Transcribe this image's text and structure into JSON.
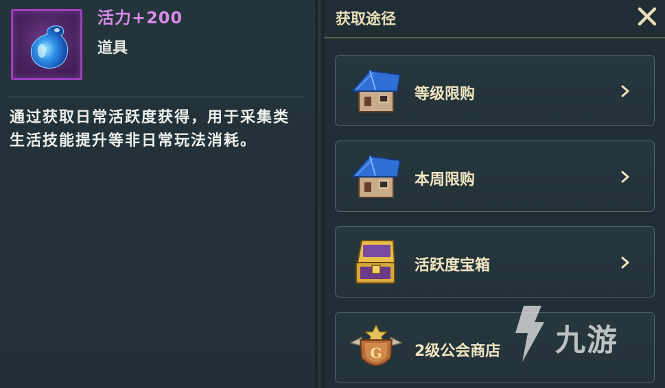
{
  "item": {
    "name": "活力+200",
    "type": "道具",
    "description": "通过获取日常活跃度获得，用于采集类生活技能提升等非日常玩法消耗。",
    "icon": "blue-droplet-icon"
  },
  "acquire_panel": {
    "title": "获取途径",
    "close_icon": "close-icon",
    "sources": [
      {
        "label": "等级限购",
        "icon": "blue-roof-house-icon"
      },
      {
        "label": "本周限购",
        "icon": "blue-roof-house-icon"
      },
      {
        "label": "活跃度宝箱",
        "icon": "gold-treasure-chest-icon"
      },
      {
        "label": "2级公会商店",
        "icon": "guild-shield-icon"
      }
    ]
  },
  "watermark": {
    "text": "九游"
  },
  "colors": {
    "item_name": "#d98ae8",
    "accent_gold": "#e8dfb8",
    "frame_purple": "#a13ec0"
  }
}
